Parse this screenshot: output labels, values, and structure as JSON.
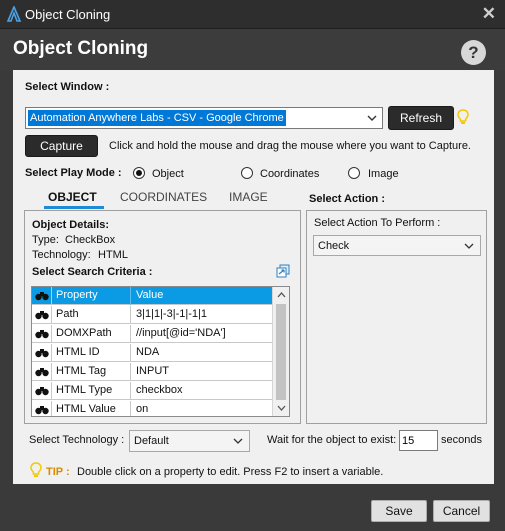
{
  "window": {
    "title": "Object Cloning",
    "close_glyph": "✕",
    "app_icon": "automation-anywhere-logo-icon"
  },
  "header": {
    "heading": "Object Cloning",
    "help_glyph": "?"
  },
  "select_window": {
    "label": "Select Window :",
    "value": "Automation Anywhere Labs - CSV - Google Chrome",
    "refresh_label": "Refresh"
  },
  "capture": {
    "button_label": "Capture",
    "hint": "Click and hold the mouse and drag the mouse where you want to Capture."
  },
  "play_mode": {
    "label": "Select Play Mode :",
    "options": [
      {
        "label": "Object",
        "selected": true
      },
      {
        "label": "Coordinates",
        "selected": false
      },
      {
        "label": "Image",
        "selected": false
      }
    ]
  },
  "tabs": [
    {
      "label": "OBJECT",
      "active": true
    },
    {
      "label": "COORDINATES",
      "active": false
    },
    {
      "label": "IMAGE",
      "active": false
    }
  ],
  "object_details": {
    "heading": "Object Details:",
    "type_label": "Type:",
    "type_value": "CheckBox",
    "tech_label": "Technology:",
    "tech_value": "HTML",
    "criteria_label": "Select Search Criteria :"
  },
  "criteria_table": {
    "headers": [
      "Property",
      "Value"
    ],
    "rows": [
      [
        "Path",
        "3|1|1|-3|-1|-1|1"
      ],
      [
        "DOMXPath",
        "//input[@id='NDA']"
      ],
      [
        "HTML ID",
        "NDA"
      ],
      [
        "HTML Tag",
        "INPUT"
      ],
      [
        "HTML Type",
        "checkbox"
      ],
      [
        "HTML Value",
        "on"
      ]
    ]
  },
  "action": {
    "section_label": "Select Action :",
    "perform_label": "Select Action To Perform :",
    "value": "Check"
  },
  "technology": {
    "label": "Select Technology :",
    "value": "Default"
  },
  "wait": {
    "label": "Wait for the object to exist:",
    "value": "15",
    "unit": "seconds"
  },
  "tip": {
    "label": "TIP :",
    "text": "Double click on a property to edit. Press F2 to insert a variable."
  },
  "footer": {
    "save_label": "Save",
    "cancel_label": "Cancel"
  },
  "colors": {
    "accent": "#0a9be4",
    "title_bg": "#2e2e2e",
    "panel_bg": "#f0f0f0",
    "tip_label": "#d98a00",
    "bulb": "#f5c800"
  }
}
